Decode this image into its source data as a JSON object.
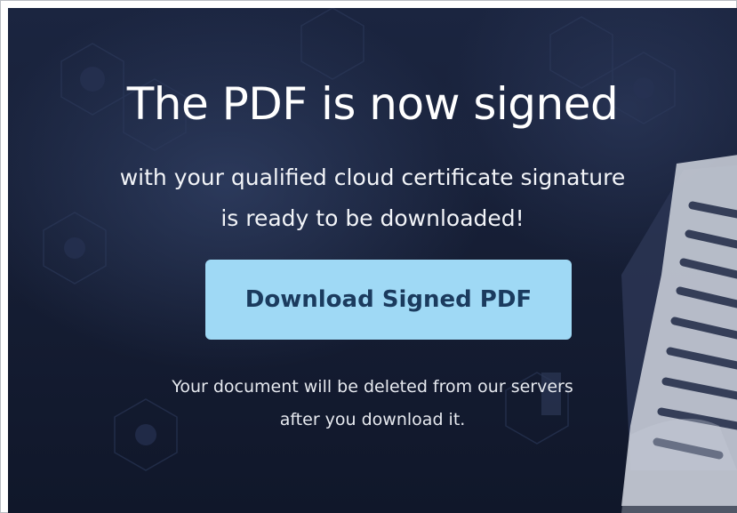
{
  "hero": {
    "headline": "The PDF is now signed",
    "subtitle_line1": "with your qualified cloud certificate signature",
    "subtitle_line2": "is ready to be downloaded!",
    "download_button_label": "Download Signed PDF",
    "note_line1": "Your document will be deleted from our servers",
    "note_line2": "after you download it."
  },
  "colors": {
    "background": "#151d33",
    "button": "#9fd9f5",
    "button_text": "#1b3b5e",
    "text": "#ffffff"
  },
  "icons": [
    "document-illustration",
    "hexagon-pattern"
  ]
}
